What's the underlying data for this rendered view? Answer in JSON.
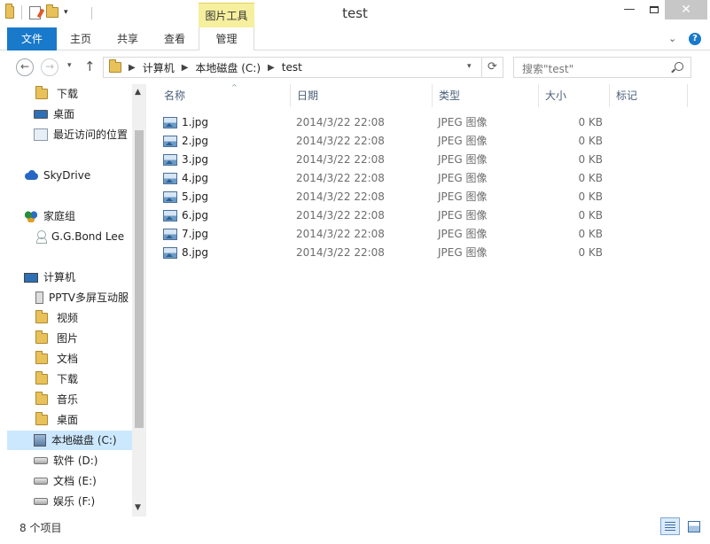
{
  "window": {
    "title": "test",
    "tool_tab_header": "图片工具",
    "close_glyph": "✕",
    "minimize_glyph": "—"
  },
  "ribbon": {
    "tabs": [
      "文件",
      "主页",
      "共享",
      "查看",
      "管理"
    ]
  },
  "address": {
    "crumbs": [
      "计算机",
      "本地磁盘 (C:)",
      "test"
    ]
  },
  "search": {
    "placeholder": "搜索\"test\""
  },
  "sidebar": {
    "items": [
      {
        "label": "下载",
        "icon": "folder-icon"
      },
      {
        "label": "桌面",
        "icon": "desktop-icon"
      },
      {
        "label": "最近访问的位置",
        "icon": "recent-places-icon"
      },
      {
        "label": "SkyDrive",
        "icon": "skydrive-cloud-icon"
      },
      {
        "label": "家庭组",
        "icon": "homegroup-icon"
      },
      {
        "label": "G.G.Bond Lee",
        "icon": "user-icon"
      },
      {
        "label": "计算机",
        "icon": "computer-icon"
      },
      {
        "label": "PPTV多屏互动服",
        "icon": "phone-icon"
      },
      {
        "label": "视频",
        "icon": "folder-icon"
      },
      {
        "label": "图片",
        "icon": "folder-icon"
      },
      {
        "label": "文档",
        "icon": "folder-icon"
      },
      {
        "label": "下载",
        "icon": "folder-icon"
      },
      {
        "label": "音乐",
        "icon": "folder-icon"
      },
      {
        "label": "桌面",
        "icon": "folder-icon"
      },
      {
        "label": "本地磁盘 (C:)",
        "icon": "system-drive-icon",
        "selected": true
      },
      {
        "label": "软件 (D:)",
        "icon": "drive-icon"
      },
      {
        "label": "文档 (E:)",
        "icon": "drive-icon"
      },
      {
        "label": "娱乐 (F:)",
        "icon": "drive-icon"
      }
    ]
  },
  "file_list": {
    "columns": [
      "名称",
      "日期",
      "类型",
      "大小",
      "标记"
    ],
    "rows": [
      {
        "name": "1.jpg",
        "date": "2014/3/22 22:08",
        "type": "JPEG 图像",
        "size": "0 KB"
      },
      {
        "name": "2.jpg",
        "date": "2014/3/22 22:08",
        "type": "JPEG 图像",
        "size": "0 KB"
      },
      {
        "name": "3.jpg",
        "date": "2014/3/22 22:08",
        "type": "JPEG 图像",
        "size": "0 KB"
      },
      {
        "name": "4.jpg",
        "date": "2014/3/22 22:08",
        "type": "JPEG 图像",
        "size": "0 KB"
      },
      {
        "name": "5.jpg",
        "date": "2014/3/22 22:08",
        "type": "JPEG 图像",
        "size": "0 KB"
      },
      {
        "name": "6.jpg",
        "date": "2014/3/22 22:08",
        "type": "JPEG 图像",
        "size": "0 KB"
      },
      {
        "name": "7.jpg",
        "date": "2014/3/22 22:08",
        "type": "JPEG 图像",
        "size": "0 KB"
      },
      {
        "name": "8.jpg",
        "date": "2014/3/22 22:08",
        "type": "JPEG 图像",
        "size": "0 KB"
      }
    ]
  },
  "status": {
    "item_count": "8 个项目"
  },
  "colors": {
    "file_tab_bg": "#1979ca",
    "tool_tab_bg": "#f6ef9e",
    "selected_bg": "#cce8ff",
    "column_header_text": "#4c607a"
  }
}
